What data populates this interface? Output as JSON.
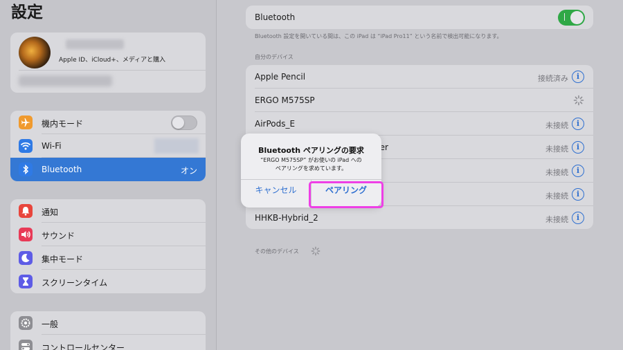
{
  "sidebar": {
    "title": "設定",
    "profile_sub": "Apple ID、iCloud+、メディアと購入",
    "connect_items": [
      {
        "label": "機内モード",
        "icon": "airplane-icon",
        "icon_color": "#f09a2e"
      },
      {
        "label": "Wi-Fi",
        "icon": "wifi-icon",
        "icon_color": "#2f7ae5"
      },
      {
        "label": "Bluetooth",
        "icon": "bluetooth-icon",
        "icon_color": "#2f7ae5",
        "value": "オン",
        "selected": true
      }
    ],
    "notify_items": [
      {
        "label": "通知",
        "icon": "bell-icon",
        "icon_color": "#e8453c"
      },
      {
        "label": "サウンド",
        "icon": "speaker-icon",
        "icon_color": "#e83a57"
      },
      {
        "label": "集中モード",
        "icon": "moon-icon",
        "icon_color": "#5e5ce6"
      },
      {
        "label": "スクリーンタイム",
        "icon": "hourglass-icon",
        "icon_color": "#5e5ce6"
      }
    ],
    "general_items": [
      {
        "label": "一般",
        "icon": "gear-icon",
        "icon_color": "#8e8e93"
      },
      {
        "label": "コントロールセンター",
        "icon": "toggles-icon",
        "icon_color": "#8e8e93"
      }
    ]
  },
  "main": {
    "bluetooth_label": "Bluetooth",
    "bluetooth_on": true,
    "note": "Bluetooth 設定を開いている間は、この iPad は “iPad Pro11” という名前で検出可能になります。",
    "my_devices_header": "自分のデバイス",
    "devices": [
      {
        "name": "Apple Pencil",
        "status": "接続済み"
      },
      {
        "name": "ERGO M575SP",
        "status": ""
      },
      {
        "name": "AirPods_E",
        "status": "未接続"
      },
      {
        "name": "ller",
        "status": "未接続"
      },
      {
        "name": "",
        "status": "未接続"
      },
      {
        "name": "",
        "status": "未接続"
      },
      {
        "name": "HHKB-Hybrid_2",
        "status": "未接続"
      }
    ],
    "other_devices_header": "その他のデバイス"
  },
  "alert": {
    "title": "Bluetooth ペアリングの要求",
    "message_line1": "“ERGO M575SP” がお使いの iPad への",
    "message_line2": "ペアリングを求めています。",
    "cancel_label": "キャンセル",
    "pair_label": "ペアリング"
  },
  "colors": {
    "accent": "#2e6fd0",
    "selected_row": "#3478d4",
    "toggle_on": "#2fa846",
    "highlight": "#ee3fe6"
  }
}
